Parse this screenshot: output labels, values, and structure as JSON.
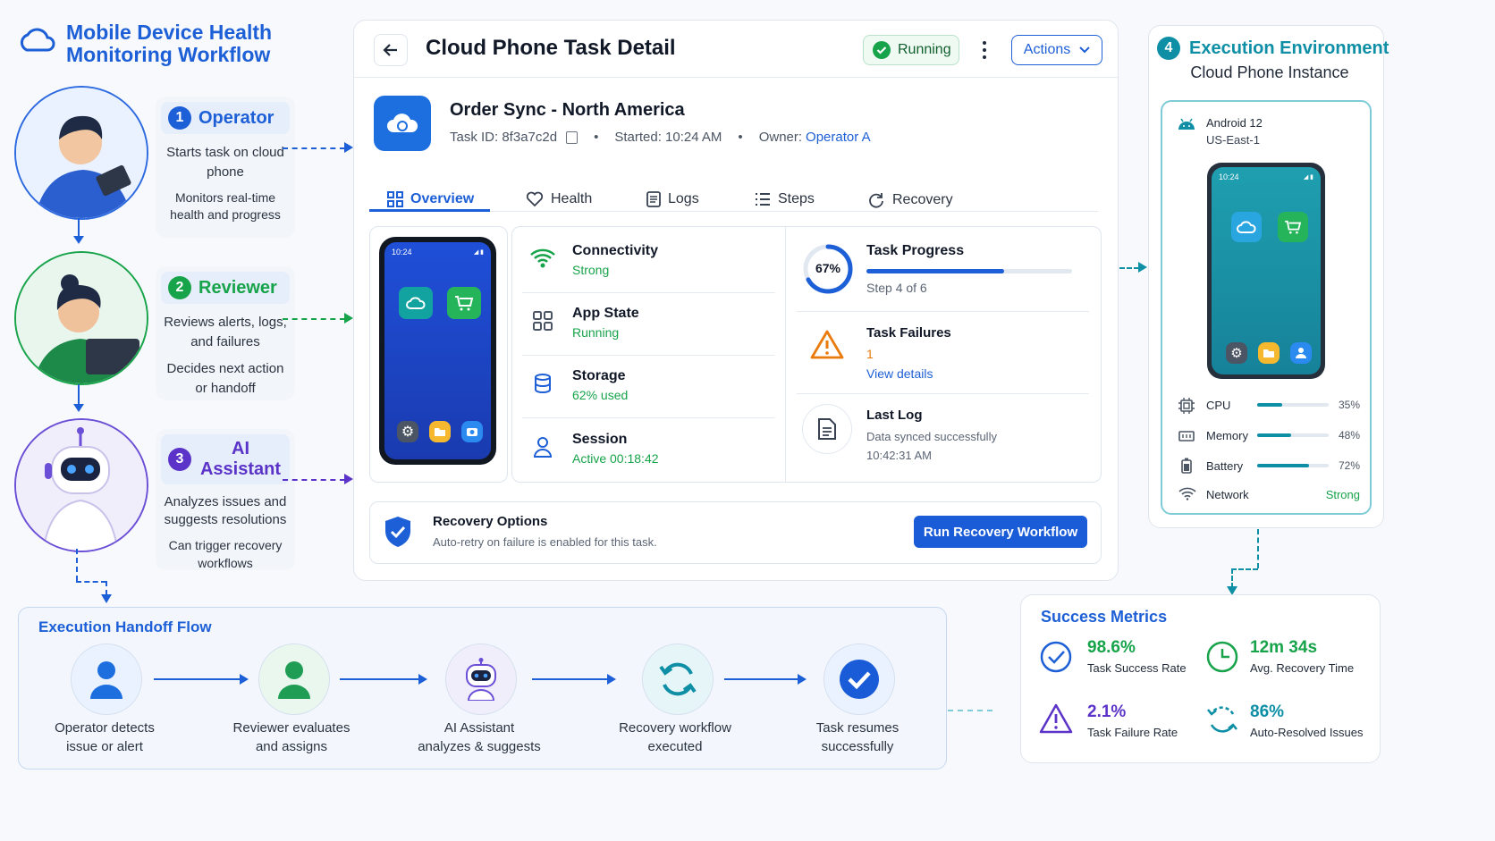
{
  "header": {
    "title_line1": "Mobile Device Health",
    "title_line2": "Monitoring Workflow"
  },
  "roles": [
    {
      "num": "1",
      "title": "Operator",
      "desc1": "Starts task on cloud phone",
      "desc2": "Monitors real-time health and progress"
    },
    {
      "num": "2",
      "title": "Reviewer",
      "desc1": "Reviews alerts, logs, and failures",
      "desc2": "Decides next action or handoff"
    },
    {
      "num": "3",
      "title": "AI Assistant",
      "desc1": "Analyzes issues and suggests resolutions",
      "desc2": "Can trigger recovery workflows"
    }
  ],
  "detail": {
    "title": "Cloud Phone Task Detail",
    "status": "Running",
    "actions_label": "Actions",
    "task_name": "Order Sync - North America",
    "task_id_label": "Task ID: 8f3a7c2d",
    "started_label": "Started: 10:24 AM",
    "owner_label": "Owner:",
    "owner_value": "Operator A",
    "tabs": [
      "Overview",
      "Health",
      "Logs",
      "Steps",
      "Recovery"
    ],
    "phone_time": "10:24",
    "metrics": [
      {
        "title": "Connectivity",
        "value": "Strong"
      },
      {
        "title": "App State",
        "value": "Running"
      },
      {
        "title": "Storage",
        "value": "62% used"
      },
      {
        "title": "Session",
        "value": "Active 00:18:42"
      }
    ],
    "progress": {
      "title": "Task Progress",
      "percent_label": "67%",
      "fraction": 0.67,
      "step": "Step 4 of 6"
    },
    "failures": {
      "title": "Task Failures",
      "count": "1",
      "link": "View details"
    },
    "last_log": {
      "title": "Last Log",
      "message": "Data synced successfully",
      "time": "10:42:31 AM"
    },
    "recovery": {
      "title": "Recovery Options",
      "desc": "Auto-retry on failure is enabled for this task.",
      "button": "Run Recovery Workflow"
    }
  },
  "environment": {
    "num": "4",
    "title": "Execution Environment",
    "subtitle": "Cloud Phone Instance",
    "os": "Android 12",
    "region": "US-East-1",
    "phone_time": "10:24",
    "resources": [
      {
        "name": "CPU",
        "value": "35%",
        "fraction": 0.35
      },
      {
        "name": "Memory",
        "value": "48%",
        "fraction": 0.48
      },
      {
        "name": "Battery",
        "value": "72%",
        "fraction": 0.72
      },
      {
        "name": "Network",
        "value": "Strong"
      }
    ]
  },
  "handoff": {
    "title": "Execution Handoff Flow",
    "steps": [
      {
        "line1": "Operator detects",
        "line2": "issue or alert"
      },
      {
        "line1": "Reviewer evaluates",
        "line2": "and assigns"
      },
      {
        "line1": "AI Assistant",
        "line2": "analyzes & suggests"
      },
      {
        "line1": "Recovery workflow",
        "line2": "executed"
      },
      {
        "line1": "Task resumes",
        "line2": "successfully"
      }
    ]
  },
  "success": {
    "title": "Success Metrics",
    "items": [
      {
        "value": "98.6%",
        "label": "Task Success Rate"
      },
      {
        "value": "12m 34s",
        "label": "Avg. Recovery Time"
      },
      {
        "value": "2.1%",
        "label": "Task Failure Rate"
      },
      {
        "value": "86%",
        "label": "Auto-Resolved Issues"
      }
    ]
  }
}
